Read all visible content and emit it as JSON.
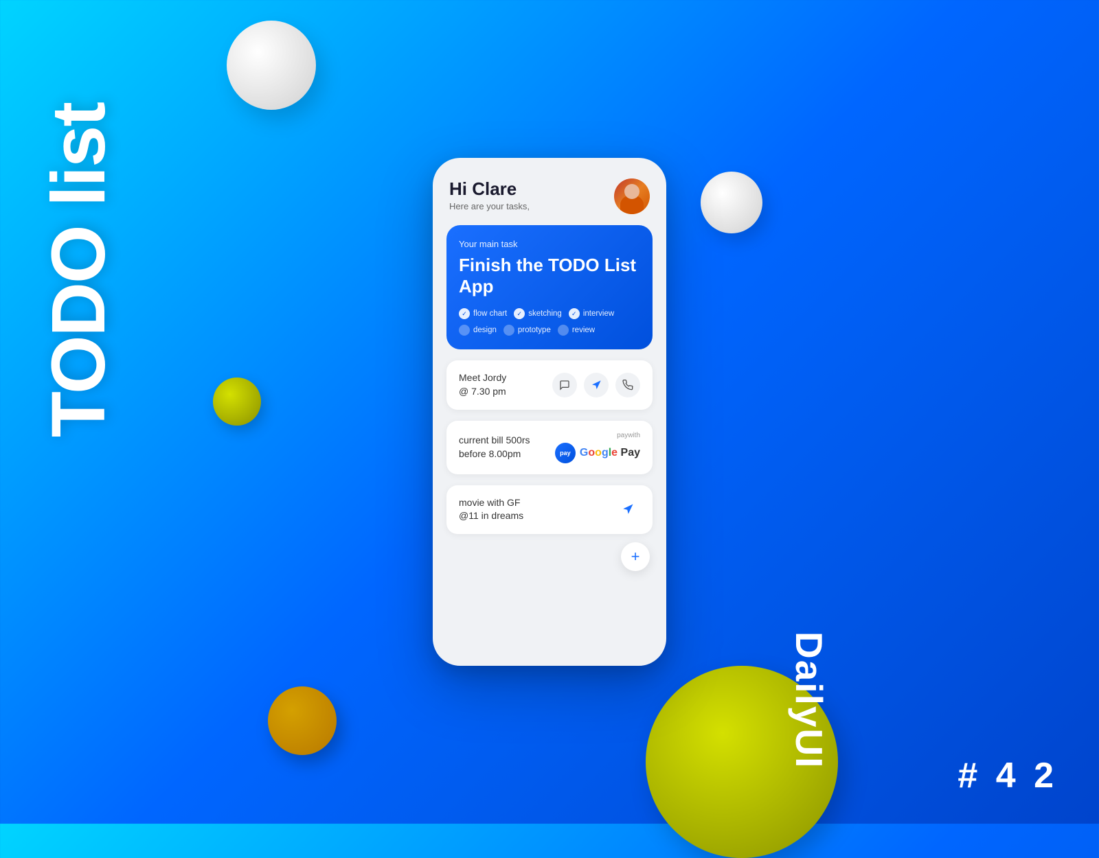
{
  "background": {
    "gradient_start": "#00d4ff",
    "gradient_end": "#0044cc"
  },
  "branding": {
    "todo_title": "TODO list",
    "daily_ui": "DailyUI",
    "challenge_number": "# 4 2"
  },
  "phone": {
    "header": {
      "greeting_name": "Hi Clare",
      "greeting_sub": "Here are your tasks,",
      "avatar_alt": "Clare avatar"
    },
    "main_task": {
      "label": "Your main task",
      "title": "Finish the TODO List App",
      "tags": [
        {
          "label": "flow chart",
          "done": true
        },
        {
          "label": "sketching",
          "done": true
        },
        {
          "label": "interview",
          "done": true
        },
        {
          "label": "design",
          "done": false
        },
        {
          "label": "prototype",
          "done": false
        },
        {
          "label": "review",
          "done": false
        }
      ]
    },
    "tasks": [
      {
        "id": 1,
        "text_line1": "Meet Jordy",
        "text_line2": "@ 7.30 pm",
        "actions": [
          "message",
          "navigation",
          "phone"
        ]
      },
      {
        "id": 2,
        "text_line1": "current bill 500rs",
        "text_line2": "before 8.00pm",
        "payment": {
          "label": "paywith",
          "providers": [
            "G Pay",
            "Google Pay"
          ]
        }
      },
      {
        "id": 3,
        "text_line1": "movie with GF",
        "text_line2": "@11 in dreams",
        "actions": [
          "navigation"
        ]
      }
    ],
    "add_button_label": "+"
  }
}
